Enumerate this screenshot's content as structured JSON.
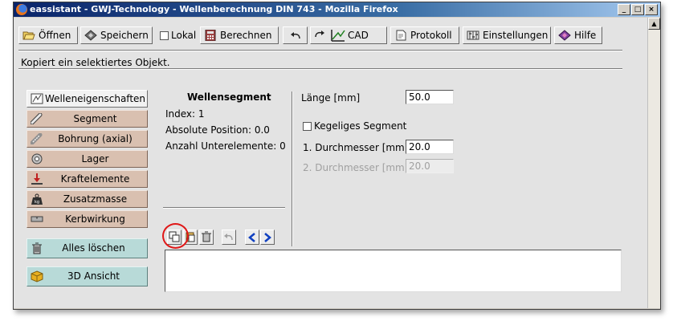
{
  "window": {
    "title": "eassistant - GWJ-Technology - Wellenberechnung DIN 743 - Mozilla Firefox",
    "controls": [
      "_",
      "□",
      "×"
    ]
  },
  "toolbar": {
    "open_label": "Öffnen",
    "save_label": "Speichern",
    "local_label": "Lokal",
    "local_checked": false,
    "calculate_label": "Berechnen",
    "cad_label": "CAD",
    "protocol_label": "Protokoll",
    "settings_label": "Einstellungen",
    "help_label": "Hilfe"
  },
  "status": "Kopiert ein selektiertes Objekt.",
  "nav": {
    "items": [
      {
        "label": "Welleneigenschaften",
        "icon": "shaft-properties-icon"
      },
      {
        "label": "Segment",
        "icon": "segment-icon"
      },
      {
        "label": "Bohrung (axial)",
        "icon": "bore-icon"
      },
      {
        "label": "Lager",
        "icon": "bearing-icon"
      },
      {
        "label": "Kraftelemente",
        "icon": "force-icon"
      },
      {
        "label": "Zusatzmasse",
        "icon": "mass-icon"
      },
      {
        "label": "Kerbwirkung",
        "icon": "notch-icon"
      }
    ],
    "delete_all_label": "Alles löschen",
    "view_3d_label": "3D Ansicht"
  },
  "segment_info": {
    "title": "Wellensegment",
    "index": "Index: 1",
    "position": "Absolute Position: 0.0",
    "sub_elements": "Anzahl Unterelemente: 0"
  },
  "properties": {
    "length_label": "Länge [mm]",
    "length_value": "50.0",
    "conical_label": "Kegeliges Segment",
    "conical_checked": false,
    "diameter1_label": "1. Durchmesser [mm]",
    "diameter1_value": "20.0",
    "diameter2_label": "2. Durchmesser [mm]",
    "diameter2_value": "20.0"
  },
  "colors": {
    "nav_button": "#d9c0b0",
    "action_button": "#b8dad8",
    "highlight_circle": "#e01818"
  }
}
